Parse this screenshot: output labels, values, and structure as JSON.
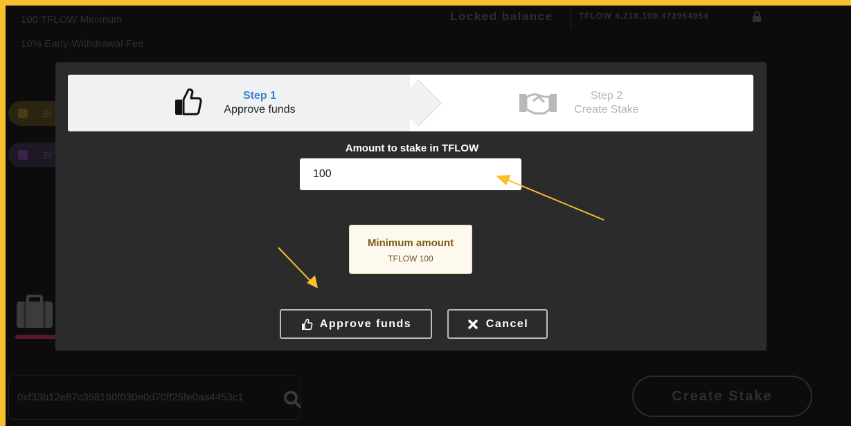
{
  "background": {
    "info_lines": [
      "100 TFLOW Minimum",
      "10% Early-Withdrawal Fee"
    ],
    "locked_balance_label": "Locked balance",
    "locked_balance_value": "TFLOW 4,218,109.472964954",
    "pills": [
      "Bl",
      "St"
    ],
    "address_value": "0xf33b12e87c358160f030e0d70ff25fe0aa4453c1",
    "create_stake_label": "Create Stake"
  },
  "modal": {
    "steps": [
      {
        "number": "Step 1",
        "label": "Approve funds",
        "icon": "thumbs-up-icon",
        "state": "active"
      },
      {
        "number": "Step 2",
        "label": "Create Stake",
        "icon": "handshake-icon",
        "state": "inactive"
      }
    ],
    "amount_label": "Amount to stake in TFLOW",
    "amount_value": "100",
    "minimum": {
      "title": "Minimum amount",
      "value": "TFLOW 100"
    },
    "buttons": {
      "approve": "Approve funds",
      "cancel": "Cancel"
    }
  },
  "colors": {
    "border": "#f7bf2e",
    "modal_bg": "#2b2b2b",
    "step_active": "#3a7fc9",
    "annotation_arrow": "#f7bf2e"
  }
}
